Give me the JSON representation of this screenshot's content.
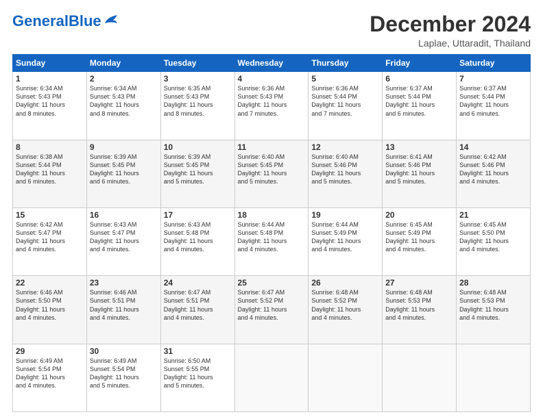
{
  "header": {
    "logo_general": "General",
    "logo_blue": "Blue",
    "month_title": "December 2024",
    "location": "Laplae, Uttaradit, Thailand"
  },
  "weekdays": [
    "Sunday",
    "Monday",
    "Tuesday",
    "Wednesday",
    "Thursday",
    "Friday",
    "Saturday"
  ],
  "weeks": [
    [
      {
        "day": "1",
        "info": "Sunrise: 6:34 AM\nSunset: 5:43 PM\nDaylight: 11 hours\nand 8 minutes."
      },
      {
        "day": "2",
        "info": "Sunrise: 6:34 AM\nSunset: 5:43 PM\nDaylight: 11 hours\nand 8 minutes."
      },
      {
        "day": "3",
        "info": "Sunrise: 6:35 AM\nSunset: 5:43 PM\nDaylight: 11 hours\nand 8 minutes."
      },
      {
        "day": "4",
        "info": "Sunrise: 6:36 AM\nSunset: 5:43 PM\nDaylight: 11 hours\nand 7 minutes."
      },
      {
        "day": "5",
        "info": "Sunrise: 6:36 AM\nSunset: 5:44 PM\nDaylight: 11 hours\nand 7 minutes."
      },
      {
        "day": "6",
        "info": "Sunrise: 6:37 AM\nSunset: 5:44 PM\nDaylight: 11 hours\nand 6 minutes."
      },
      {
        "day": "7",
        "info": "Sunrise: 6:37 AM\nSunset: 5:44 PM\nDaylight: 11 hours\nand 6 minutes."
      }
    ],
    [
      {
        "day": "8",
        "info": "Sunrise: 6:38 AM\nSunset: 5:44 PM\nDaylight: 11 hours\nand 6 minutes."
      },
      {
        "day": "9",
        "info": "Sunrise: 6:39 AM\nSunset: 5:45 PM\nDaylight: 11 hours\nand 6 minutes."
      },
      {
        "day": "10",
        "info": "Sunrise: 6:39 AM\nSunset: 5:45 PM\nDaylight: 11 hours\nand 5 minutes."
      },
      {
        "day": "11",
        "info": "Sunrise: 6:40 AM\nSunset: 5:45 PM\nDaylight: 11 hours\nand 5 minutes."
      },
      {
        "day": "12",
        "info": "Sunrise: 6:40 AM\nSunset: 5:46 PM\nDaylight: 11 hours\nand 5 minutes."
      },
      {
        "day": "13",
        "info": "Sunrise: 6:41 AM\nSunset: 5:46 PM\nDaylight: 11 hours\nand 5 minutes."
      },
      {
        "day": "14",
        "info": "Sunrise: 6:42 AM\nSunset: 5:46 PM\nDaylight: 11 hours\nand 4 minutes."
      }
    ],
    [
      {
        "day": "15",
        "info": "Sunrise: 6:42 AM\nSunset: 5:47 PM\nDaylight: 11 hours\nand 4 minutes."
      },
      {
        "day": "16",
        "info": "Sunrise: 6:43 AM\nSunset: 5:47 PM\nDaylight: 11 hours\nand 4 minutes."
      },
      {
        "day": "17",
        "info": "Sunrise: 6:43 AM\nSunset: 5:48 PM\nDaylight: 11 hours\nand 4 minutes."
      },
      {
        "day": "18",
        "info": "Sunrise: 6:44 AM\nSunset: 5:48 PM\nDaylight: 11 hours\nand 4 minutes."
      },
      {
        "day": "19",
        "info": "Sunrise: 6:44 AM\nSunset: 5:49 PM\nDaylight: 11 hours\nand 4 minutes."
      },
      {
        "day": "20",
        "info": "Sunrise: 6:45 AM\nSunset: 5:49 PM\nDaylight: 11 hours\nand 4 minutes."
      },
      {
        "day": "21",
        "info": "Sunrise: 6:45 AM\nSunset: 5:50 PM\nDaylight: 11 hours\nand 4 minutes."
      }
    ],
    [
      {
        "day": "22",
        "info": "Sunrise: 6:46 AM\nSunset: 5:50 PM\nDaylight: 11 hours\nand 4 minutes."
      },
      {
        "day": "23",
        "info": "Sunrise: 6:46 AM\nSunset: 5:51 PM\nDaylight: 11 hours\nand 4 minutes."
      },
      {
        "day": "24",
        "info": "Sunrise: 6:47 AM\nSunset: 5:51 PM\nDaylight: 11 hours\nand 4 minutes."
      },
      {
        "day": "25",
        "info": "Sunrise: 6:47 AM\nSunset: 5:52 PM\nDaylight: 11 hours\nand 4 minutes."
      },
      {
        "day": "26",
        "info": "Sunrise: 6:48 AM\nSunset: 5:52 PM\nDaylight: 11 hours\nand 4 minutes."
      },
      {
        "day": "27",
        "info": "Sunrise: 6:48 AM\nSunset: 5:53 PM\nDaylight: 11 hours\nand 4 minutes."
      },
      {
        "day": "28",
        "info": "Sunrise: 6:48 AM\nSunset: 5:53 PM\nDaylight: 11 hours\nand 4 minutes."
      }
    ],
    [
      {
        "day": "29",
        "info": "Sunrise: 6:49 AM\nSunset: 5:54 PM\nDaylight: 11 hours\nand 4 minutes."
      },
      {
        "day": "30",
        "info": "Sunrise: 6:49 AM\nSunset: 5:54 PM\nDaylight: 11 hours\nand 5 minutes."
      },
      {
        "day": "31",
        "info": "Sunrise: 6:50 AM\nSunset: 5:55 PM\nDaylight: 11 hours\nand 5 minutes."
      },
      {
        "day": "",
        "info": ""
      },
      {
        "day": "",
        "info": ""
      },
      {
        "day": "",
        "info": ""
      },
      {
        "day": "",
        "info": ""
      }
    ]
  ]
}
